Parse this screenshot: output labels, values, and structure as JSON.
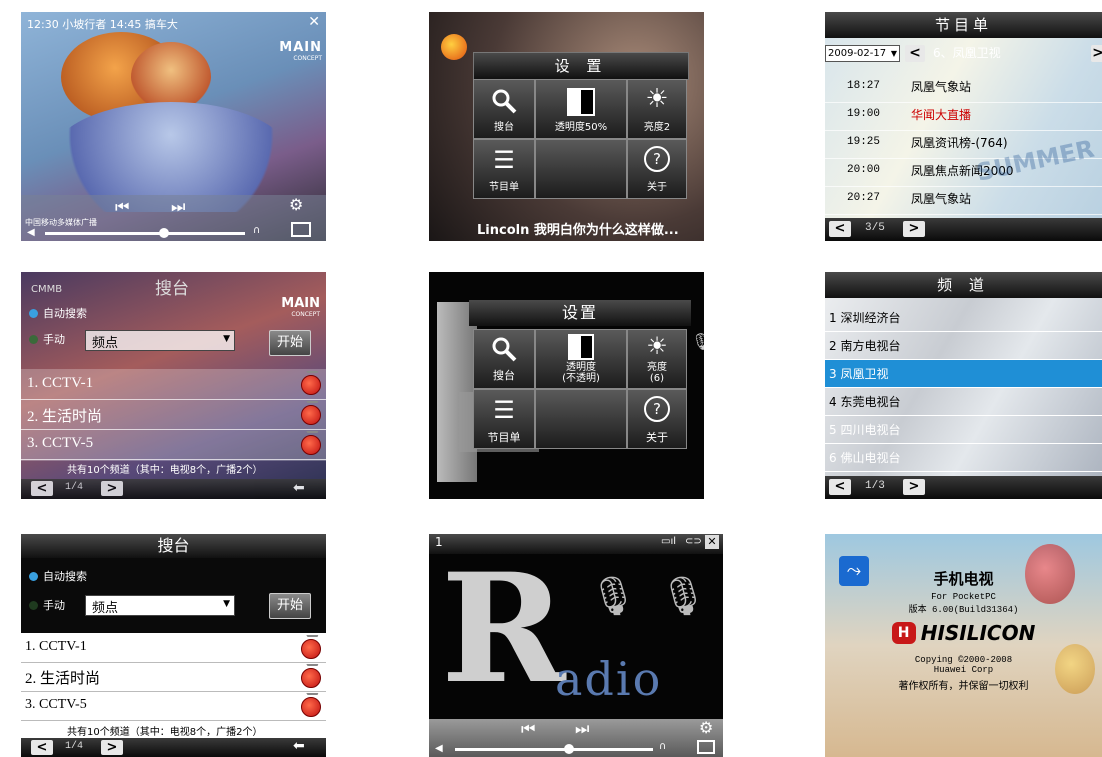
{
  "s1": {
    "status": "12:30 小坡行者   14:45 搞车大",
    "logo_main": "MAIN",
    "logo_sub": "CONCEPT",
    "subtitle": "中国移动多媒体广播",
    "icons": [
      "prev-icon",
      "next-icon",
      "gear-icon",
      "volume-icon",
      "headphone-icon",
      "screen-icon"
    ]
  },
  "s2": {
    "title": "设 置",
    "cells": [
      {
        "label": "搜台",
        "icon": "search-icon"
      },
      {
        "label": "透明度50%",
        "icon": "transparency-icon"
      },
      {
        "label": "亮度2",
        "icon": "brightness-icon"
      },
      {
        "label": "节目单",
        "icon": "list-icon"
      },
      {
        "label": "",
        "icon": ""
      },
      {
        "label": "关于",
        "icon": "about-icon"
      }
    ],
    "caption": "Lincoln 我明白你为什么这样做..."
  },
  "s3": {
    "title": "节目单",
    "date": "2009-02-17",
    "channel": "6、凤凰卫视",
    "rows": [
      {
        "time": "18:27",
        "name": "凤凰气象站"
      },
      {
        "time": "19:00",
        "name": "华闻大直播"
      },
      {
        "time": "19:25",
        "name": "凤凰资讯榜-(764)"
      },
      {
        "time": "20:00",
        "name": "凤凰焦点新闻2000"
      },
      {
        "time": "20:27",
        "name": "凤凰气象站"
      }
    ],
    "page": "3/5",
    "bg_text": "SUMMER OUT"
  },
  "s4": {
    "status_left": "CMMB",
    "title": "搜台",
    "logo_main": "MAIN",
    "logo_sub": "CONCEPT",
    "auto": "自动搜索",
    "manual": "手动",
    "select_value": "频点",
    "start": "开始",
    "rows": [
      "1. CCTV-1",
      "2. 生活时尚",
      "3. CCTV-5"
    ],
    "summary": "共有10个频道（其中：电视8个，广播2个）",
    "page": "1/4"
  },
  "s5": {
    "title": "设置",
    "cells": [
      {
        "label": "搜台",
        "icon": "search-icon"
      },
      {
        "label": "透明度\n(不透明)",
        "icon": "transparency-icon"
      },
      {
        "label": "亮度\n(6)",
        "icon": "brightness-icon"
      },
      {
        "label": "节目单",
        "icon": "list-icon"
      },
      {
        "label": "",
        "icon": ""
      },
      {
        "label": "关于",
        "icon": "about-icon"
      }
    ]
  },
  "s6": {
    "title": "频 道",
    "rows": [
      "1 深圳经济台",
      "2 南方电视台",
      "3 凤凰卫视",
      "4 东莞电视台",
      "5 四川电视台",
      "6 佛山电视台"
    ],
    "selected_index": 2,
    "page": "1/3"
  },
  "s7": {
    "title": "搜台",
    "auto": "自动搜索",
    "manual": "手动",
    "select_value": "频点",
    "start": "开始",
    "rows": [
      "1. CCTV-1",
      "2. 生活时尚",
      "3. CCTV-5"
    ],
    "summary": "共有10个频道（其中：电视8个，广播2个）",
    "page": "1/4"
  },
  "s8": {
    "channel_num": "1",
    "art_big": "R",
    "art_word": "adio"
  },
  "s9": {
    "title": "手机电视",
    "for": "For PocketPC",
    "version": "版本 6.00(Build31364)",
    "brand": "HISILICON",
    "copy1": "Copying  ©2000-2008",
    "copy2": "Huawei Corp",
    "rights": "著作权所有，并保留一切权利"
  },
  "colors": {
    "highlight": "#1f8fd6",
    "apple": "#d01818",
    "dark": "#111111"
  }
}
